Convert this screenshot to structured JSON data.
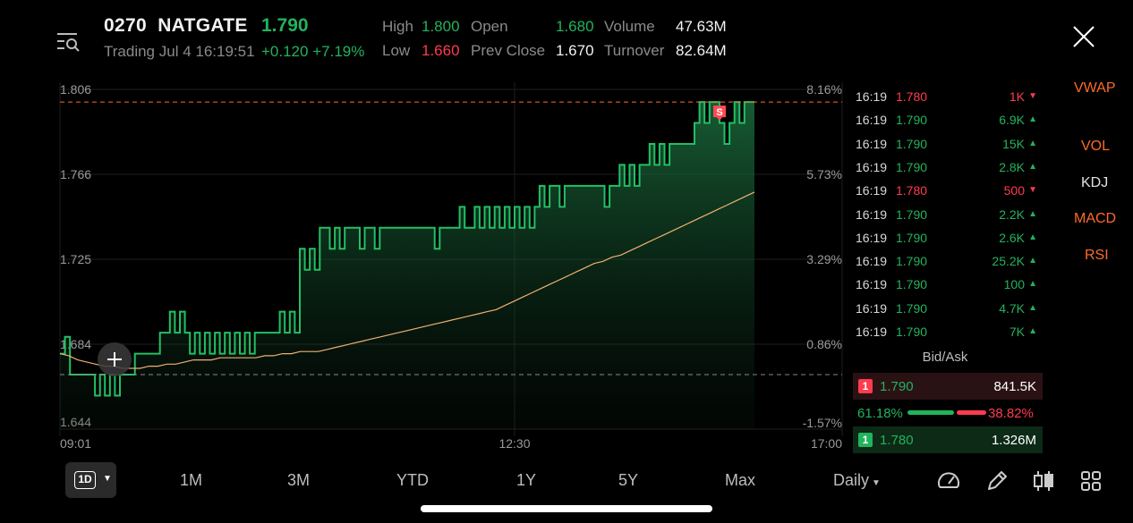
{
  "header": {
    "symbol": "0270",
    "name": "NATGATE",
    "price": "1.790",
    "trading_status": "Trading Jul 4 16:19:51",
    "change": "+0.120",
    "change_pct": "+7.19%",
    "high_label": "High",
    "high_value": "1.800",
    "low_label": "Low",
    "low_value": "1.660",
    "open_label": "Open",
    "open_value": "1.680",
    "prev_close_label": "Prev Close",
    "prev_close_value": "1.670",
    "volume_label": "Volume",
    "volume_value": "47.63M",
    "turnover_label": "Turnover",
    "turnover_value": "82.64M"
  },
  "colors": {
    "up": "#22b35e",
    "down": "#ff3b4e",
    "vwap": "#f0b070",
    "accent": "#ff6a2a"
  },
  "chart_data": {
    "type": "line",
    "y_left_ticks": [
      "1.806",
      "1.766",
      "1.725",
      "1.684",
      "1.644"
    ],
    "y_right_ticks": [
      "8.16%",
      "5.73%",
      "3.29%",
      "0.86%",
      "-1.57%"
    ],
    "x_ticks": [
      "09:01",
      "12:30",
      "17:00"
    ],
    "ylim": [
      1.644,
      1.806
    ],
    "prev_close": 1.67,
    "high_line": 1.8,
    "marker_label": "S",
    "series": [
      {
        "values": [
          1.68,
          1.688,
          1.67,
          1.67,
          1.67,
          1.67,
          1.67,
          1.66,
          1.67,
          1.66,
          1.67,
          1.66,
          1.67,
          1.67,
          1.67,
          1.68,
          1.68,
          1.68,
          1.68,
          1.68,
          1.69,
          1.69,
          1.7,
          1.69,
          1.7,
          1.69,
          1.68,
          1.69,
          1.68,
          1.69,
          1.68,
          1.69,
          1.68,
          1.69,
          1.68,
          1.69,
          1.68,
          1.69,
          1.68,
          1.69,
          1.69,
          1.69,
          1.69,
          1.69,
          1.7,
          1.69,
          1.7,
          1.69,
          1.73,
          1.72,
          1.73,
          1.72,
          1.74,
          1.74,
          1.73,
          1.74,
          1.73,
          1.74,
          1.74,
          1.74,
          1.73,
          1.74,
          1.74,
          1.73,
          1.74,
          1.74,
          1.74,
          1.74,
          1.74,
          1.74,
          1.74,
          1.74,
          1.74,
          1.74,
          1.74,
          1.73,
          1.74,
          1.74,
          1.74,
          1.74,
          1.75,
          1.74,
          1.74,
          1.75,
          1.74,
          1.75,
          1.74,
          1.75,
          1.74,
          1.75,
          1.74,
          1.75,
          1.74,
          1.75,
          1.74,
          1.75,
          1.76,
          1.75,
          1.76,
          1.76,
          1.75,
          1.76,
          1.76,
          1.76,
          1.76,
          1.76,
          1.76,
          1.76,
          1.76,
          1.75,
          1.76,
          1.76,
          1.77,
          1.76,
          1.77,
          1.76,
          1.77,
          1.77,
          1.78,
          1.77,
          1.78,
          1.77,
          1.78,
          1.78,
          1.78,
          1.78,
          1.78,
          1.79,
          1.8,
          1.79,
          1.8,
          1.8,
          1.79,
          1.78,
          1.79,
          1.8,
          1.79,
          1.8,
          1.8,
          1.8
        ]
      },
      {
        "values": [
          1.68,
          1.679,
          1.677,
          1.676,
          1.675,
          1.674,
          1.674,
          1.673,
          1.673,
          1.673,
          1.674,
          1.674,
          1.675,
          1.675,
          1.676,
          1.677,
          1.677,
          1.677,
          1.678,
          1.678,
          1.678,
          1.678,
          1.678,
          1.679,
          1.679,
          1.68,
          1.68,
          1.681,
          1.681,
          1.681,
          1.682,
          1.683,
          1.684,
          1.685,
          1.686,
          1.687,
          1.688,
          1.689,
          1.69,
          1.691,
          1.692,
          1.693,
          1.694,
          1.695,
          1.696,
          1.697,
          1.698,
          1.699,
          1.7,
          1.701,
          1.703,
          1.705,
          1.707,
          1.709,
          1.711,
          1.713,
          1.715,
          1.717,
          1.719,
          1.721,
          1.723,
          1.724,
          1.726,
          1.727,
          1.729,
          1.731,
          1.733,
          1.735,
          1.737,
          1.739,
          1.741,
          1.743,
          1.745,
          1.747,
          1.749,
          1.751,
          1.753,
          1.755,
          1.757
        ]
      }
    ]
  },
  "ticks": [
    {
      "time": "16:19",
      "price": "1.780",
      "vol": "1K",
      "dir": "down"
    },
    {
      "time": "16:19",
      "price": "1.790",
      "vol": "6.9K",
      "dir": "up"
    },
    {
      "time": "16:19",
      "price": "1.790",
      "vol": "15K",
      "dir": "up"
    },
    {
      "time": "16:19",
      "price": "1.790",
      "vol": "2.8K",
      "dir": "up"
    },
    {
      "time": "16:19",
      "price": "1.780",
      "vol": "500",
      "dir": "down"
    },
    {
      "time": "16:19",
      "price": "1.790",
      "vol": "2.2K",
      "dir": "up"
    },
    {
      "time": "16:19",
      "price": "1.790",
      "vol": "2.6K",
      "dir": "up"
    },
    {
      "time": "16:19",
      "price": "1.790",
      "vol": "25.2K",
      "dir": "up"
    },
    {
      "time": "16:19",
      "price": "1.790",
      "vol": "100",
      "dir": "up"
    },
    {
      "time": "16:19",
      "price": "1.790",
      "vol": "4.7K",
      "dir": "up"
    },
    {
      "time": "16:19",
      "price": "1.790",
      "vol": "7K",
      "dir": "up"
    }
  ],
  "bidask": {
    "title": "Bid/Ask",
    "bid_level": "1",
    "bid_price": "1.790",
    "bid_vol": "841.5K",
    "bid_pct": "61.18%",
    "ask_pct": "38.82%",
    "ask_level": "1",
    "ask_price": "1.780",
    "ask_vol": "1.326M",
    "bid_share": 0.6118
  },
  "indicators": [
    "VWAP",
    "VOL",
    "KDJ",
    "MACD",
    "RSI"
  ],
  "periods": {
    "current": "1D",
    "items": [
      "1M",
      "3M",
      "YTD",
      "1Y",
      "5Y",
      "Max"
    ],
    "interval": "Daily"
  },
  "tools": [
    "speedometer-icon",
    "pencil-icon",
    "candlestick-icon",
    "grid-icon"
  ]
}
